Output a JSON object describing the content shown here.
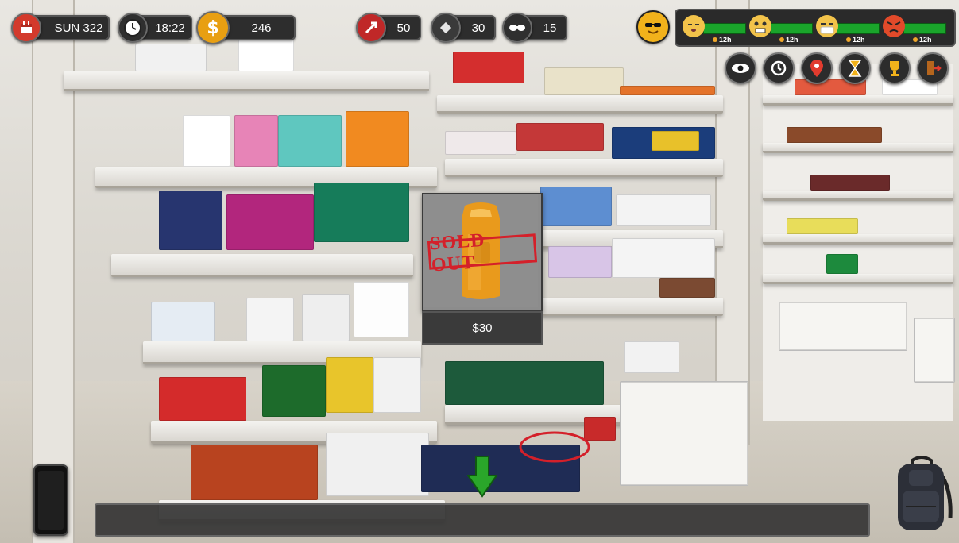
{
  "hud": {
    "day": "SUN 322",
    "time": "18:22",
    "money": "246",
    "stat_health": "50",
    "stat_cleaning": "30",
    "stat_reputation": "15"
  },
  "moods": [
    {
      "name": "sleepy-face-icon",
      "time": "12h"
    },
    {
      "name": "stressed-face-icon",
      "time": "12h"
    },
    {
      "name": "sick-face-icon",
      "time": "12h"
    },
    {
      "name": "angry-face-icon",
      "time": "12h"
    }
  ],
  "toolbar_icons": [
    "eye-icon",
    "history-icon",
    "map-pin-icon",
    "hourglass-icon",
    "trophy-icon",
    "exit-icon"
  ],
  "popup": {
    "stamp": "SOLD OUT",
    "price": "$30"
  },
  "colors": {
    "accent_gold": "#f2b21b",
    "mood_bar_green": "#1aa52b",
    "sold_out_red": "#d4202a"
  }
}
